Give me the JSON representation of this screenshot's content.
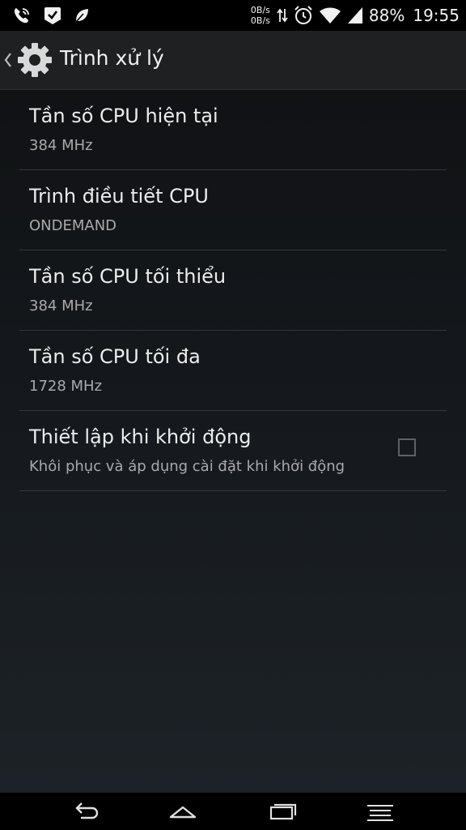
{
  "status_bar": {
    "net_up": "0B/s",
    "net_down": "0B/s",
    "battery": "88%",
    "time": "19:55",
    "left_icons": [
      "viber-icon",
      "checkmark-badge-icon",
      "leaf-icon"
    ],
    "right_icons": [
      "data-arrows-icon",
      "alarm-icon",
      "wifi-icon",
      "signal-icon"
    ]
  },
  "action_bar": {
    "title": "Trình xử lý",
    "icon": "gear-icon"
  },
  "settings": [
    {
      "title": "Tần số CPU hiện tại",
      "summary": "384 MHz"
    },
    {
      "title": "Trình điều tiết CPU",
      "summary": "ONDEMAND"
    },
    {
      "title": "Tần số CPU tối thiểu",
      "summary": "384 MHz"
    },
    {
      "title": "Tần số CPU tối đa",
      "summary": "1728 MHz"
    },
    {
      "title": "Thiết lập khi khởi động",
      "summary": "Khôi phục và áp dụng cài đặt khi khởi động",
      "checked": false
    }
  ],
  "nav_bar": {
    "buttons": [
      "back-icon",
      "home-icon",
      "recents-icon",
      "menu-icon"
    ]
  },
  "colors": {
    "background_top": "#0f1012",
    "background_bottom": "#1d2328",
    "action_bar": "#1f2021",
    "title_text": "#ececec",
    "summary_text": "#a9a9a9",
    "divider": "#33383c"
  }
}
